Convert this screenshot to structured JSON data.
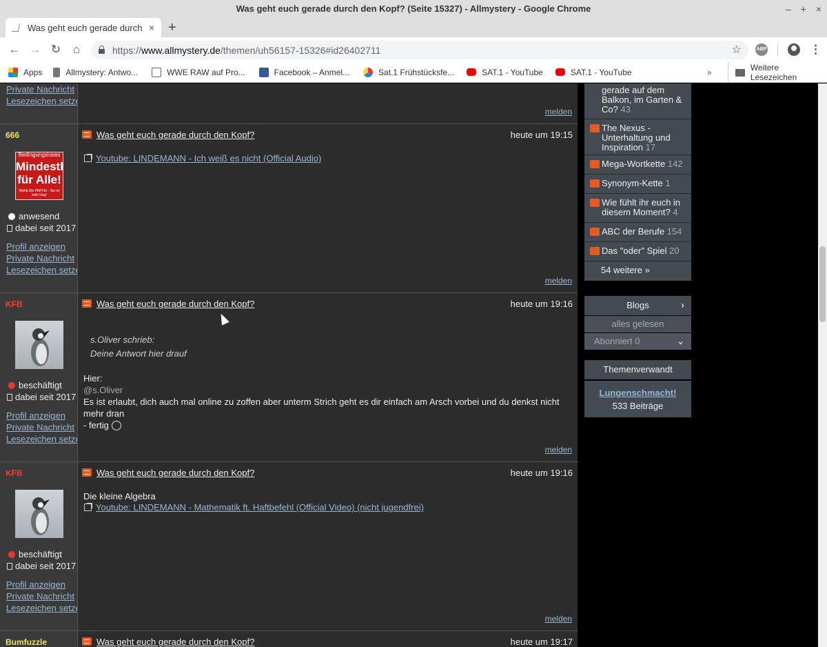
{
  "window": {
    "title": "Was geht euch gerade durch den Kopf? (Seite 15327) - Allmystery - Google Chrome",
    "controls": [
      "–",
      "+",
      "×"
    ]
  },
  "tab": {
    "title": "Was geht euch gerade durch de",
    "close": "×",
    "new_tab": "+"
  },
  "toolbar": {
    "back": "←",
    "forward": "→",
    "reload": "↻",
    "home": "⌂",
    "url_scheme": "https://",
    "url_host": "www.allmystery.de",
    "url_path": "/themen/uh56157-15326#id26402711",
    "star": "☆",
    "abp": "ABP",
    "menu": "⋮"
  },
  "bookmarks": {
    "items": [
      {
        "label": "Apps",
        "icon": "apps-icon"
      },
      {
        "label": "Allmystery: Antwo...",
        "icon": "allmystery-icon"
      },
      {
        "label": "WWE RAW auf Pro...",
        "icon": "document-icon"
      },
      {
        "label": "Facebook – Anmel...",
        "icon": "facebook-icon"
      },
      {
        "label": "Sat.1 Frühstücksfe...",
        "icon": "sat1-icon"
      },
      {
        "label": "SAT.1 - YouTube",
        "icon": "youtube-icon"
      },
      {
        "label": "SAT.1 - YouTube",
        "icon": "youtube-icon"
      }
    ],
    "more": "»",
    "folder": "Weitere Lesezeichen"
  },
  "common": {
    "profile": "Profil anzeigen",
    "pm": "Private Nachricht",
    "bookmark": "Lesezeichen setzen",
    "report": "melden",
    "thread_title": "Was geht euch gerade durch den Kopf?"
  },
  "posts": [
    {
      "user": "666",
      "avatar_text": "Mindesthirn für Alle!",
      "avatar_top": "Bedingungsloses",
      "avatar_sub": "Wählt Die PARTEI - Sie ist sehr klug!",
      "status": "anwesend",
      "since": "dabei seit 2017",
      "time": "heute um 19:15",
      "link": "Youtube: LINDEMANN - Ich weiß es nicht (Official Audio)"
    },
    {
      "user": "KFB",
      "status": "beschäftigt",
      "since": "dabei seit 2017",
      "time": "heute um 19:16",
      "quote_author": "s.Oliver schrieb:",
      "quote_text": "Deine Antwort hier drauf",
      "line1": "Hier:",
      "mention": "@s.Oliver",
      "line2": "Es ist erlaubt, dich auch mal online zu zoffen aber unterm Strich geht es dir einfach am Arsch vorbei und du denkst nicht mehr dran",
      "line3": "- fertig"
    },
    {
      "user": "KFB",
      "status": "beschäftigt",
      "since": "dabei seit 2017",
      "time": "heute um 19:16",
      "text": "Die kleine Algebra",
      "link": "Youtube: LINDEMANN - Mathematik ft. Haftbefehl (Official Video) (nicht jugendfrei)"
    },
    {
      "user": "Bumfuzzle",
      "time": "heute um 19:17"
    }
  ],
  "sidebar": {
    "threads": [
      {
        "title": "gerade auf dem Balkon, im Garten & Co?",
        "count": "43"
      },
      {
        "title": "The Nexus - Unterhaltung und Inspiration",
        "count": "17"
      },
      {
        "title": "Mega-Wortkette",
        "count": "142"
      },
      {
        "title": "Synonym-Kette",
        "count": "1"
      },
      {
        "title": "Wie fühlt ihr euch in diesem Moment?",
        "count": "4"
      },
      {
        "title": "ABC der Berufe",
        "count": "154"
      },
      {
        "title": "Das \"oder\" Spiel",
        "count": "20"
      }
    ],
    "more": "54 weitere »",
    "blogs": "Blogs",
    "all_read": "alles gelesen",
    "subscribed": "Abonniert",
    "subscribed_count": "0",
    "related": "Themenverwandt",
    "related_title": "Lungenschmacht!",
    "related_count": "533 Beiträge"
  },
  "colors": {
    "accent_orange": "#e25b22",
    "user_red": "#ff3b30",
    "user_yellow": "#f0e25c",
    "link": "#9bb6d4"
  }
}
